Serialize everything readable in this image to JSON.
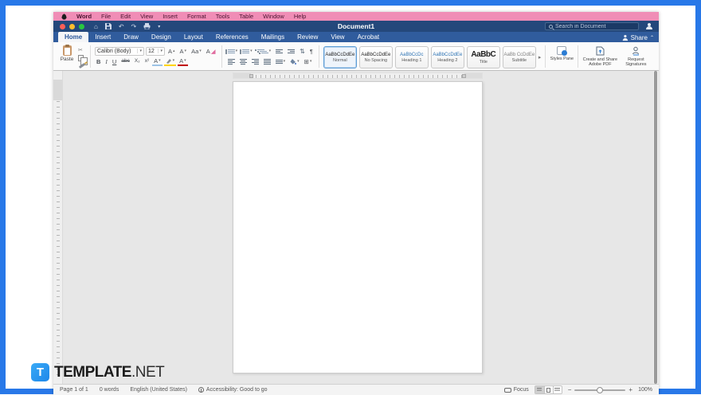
{
  "menu_bar": {
    "items": [
      "Word",
      "File",
      "Edit",
      "View",
      "Insert",
      "Format",
      "Tools",
      "Table",
      "Window",
      "Help"
    ]
  },
  "title_bar": {
    "title": "Document1",
    "search_placeholder": "Search in Document",
    "share_label": "Share"
  },
  "tabs": [
    {
      "label": "Home"
    },
    {
      "label": "Insert"
    },
    {
      "label": "Draw"
    },
    {
      "label": "Design"
    },
    {
      "label": "Layout"
    },
    {
      "label": "References"
    },
    {
      "label": "Mailings"
    },
    {
      "label": "Review"
    },
    {
      "label": "View"
    },
    {
      "label": "Acrobat"
    }
  ],
  "ribbon": {
    "paste_label": "Paste",
    "font_name": "Calibri (Body)",
    "font_size": "12",
    "bold": "B",
    "italic": "I",
    "underline": "U",
    "strikethrough": "abc",
    "subscript": "X₂",
    "superscript": "x²",
    "grow_font": "A",
    "shrink_font": "A",
    "change_case": "Aa",
    "clear_format": "A",
    "font_color": "A",
    "border_color": "A",
    "styles": [
      {
        "sample": "AaBbCcDdEe",
        "label": "Normal"
      },
      {
        "sample": "AaBbCcDdEe",
        "label": "No Spacing"
      },
      {
        "sample": "AaBbCcDc",
        "label": "Heading 1"
      },
      {
        "sample": "AaBbCcDdEe",
        "label": "Heading 2"
      },
      {
        "sample": "AaBbC",
        "label": "Title"
      },
      {
        "sample": "AaBb CcDdEe",
        "label": "Subtitle"
      }
    ],
    "styles_pane_label": "Styles Pane",
    "adobe_pdf_label": "Create and Share Adobe PDF",
    "request_signatures_label": "Request Signatures"
  },
  "icons": {
    "home": "⌂",
    "undo": "↶",
    "redo": "↷",
    "dropdown": "▾",
    "chevron_up": "⌃",
    "pilcrow": "¶",
    "scissors": "✂",
    "sort": "⇅",
    "borders_grid": "⊞",
    "more_styles": "▸",
    "up": "▴",
    "down": "▾",
    "minus": "−",
    "plus": "+"
  },
  "status_bar": {
    "page_count": "Page 1 of 1",
    "word_count": "0 words",
    "language": "English (United States)",
    "accessibility": "Accessibility: Good to go",
    "focus_label": "Focus",
    "zoom_level": "100%"
  },
  "watermark": {
    "badge": "T",
    "brand": "TEMPLATE",
    "suffix": ".NET"
  },
  "colors": {
    "frame_blue": "#2878e8",
    "accent_blue": "#2b579a",
    "heading_blue": "#2e74b5",
    "logo_blue": "#2596ef"
  }
}
